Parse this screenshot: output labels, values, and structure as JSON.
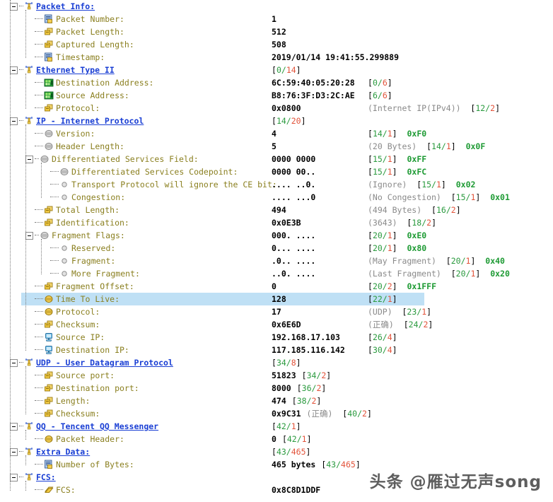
{
  "watermark": "头条 @雁过无声song",
  "rows": [
    {
      "id": "packet-info",
      "kind": "group",
      "depth": 0,
      "expander": "minus",
      "icon": "protocol-node-icon",
      "label": "Packet Info:",
      "value": "",
      "desc": "",
      "offset": "",
      "mask": ""
    },
    {
      "id": "packet-number",
      "kind": "field",
      "depth": 1,
      "expander": "none",
      "icon": "info-page-icon",
      "label": "Packet Number:",
      "value": "1",
      "desc": "",
      "offset": "",
      "mask": ""
    },
    {
      "id": "packet-length",
      "kind": "field",
      "depth": 1,
      "expander": "none",
      "icon": "bytes-icon",
      "label": "Packet Length:",
      "value": "512",
      "desc": "",
      "offset": "",
      "mask": ""
    },
    {
      "id": "captured-length",
      "kind": "field",
      "depth": 1,
      "expander": "none",
      "icon": "bytes-icon",
      "label": "Captured Length:",
      "value": "508",
      "desc": "",
      "offset": "",
      "mask": ""
    },
    {
      "id": "timestamp",
      "kind": "field",
      "depth": 1,
      "expander": "none",
      "icon": "info-page-icon",
      "label": "Timestamp:",
      "value": "2019/01/14 19:41:55.299889",
      "desc": "",
      "offset": "",
      "mask": ""
    },
    {
      "id": "ethernet-type-ii",
      "kind": "group",
      "depth": 0,
      "expander": "minus",
      "icon": "protocol-node-icon",
      "label": "Ethernet Type II",
      "value": "",
      "desc": "",
      "offset": "[0/14]",
      "mask": ""
    },
    {
      "id": "destination-address",
      "kind": "field",
      "depth": 1,
      "expander": "none",
      "icon": "nic-card-icon",
      "label": "Destination Address:",
      "value": "6C:59:40:05:20:28",
      "desc": "",
      "offset": "[0/6]",
      "mask": ""
    },
    {
      "id": "source-address",
      "kind": "field",
      "depth": 1,
      "expander": "none",
      "icon": "nic-card-icon",
      "label": "Source Address:",
      "value": "B8:76:3F:D3:2C:AE",
      "desc": "",
      "offset": "[6/6]",
      "mask": ""
    },
    {
      "id": "eth-protocol",
      "kind": "field",
      "depth": 1,
      "expander": "none",
      "icon": "bytes-icon",
      "label": "Protocol:",
      "value": "0x0800",
      "desc": "(Internet IP(IPv4))",
      "offset": "[12/2]",
      "mask": ""
    },
    {
      "id": "ip-internet-protocol",
      "kind": "group",
      "depth": 0,
      "expander": "minus",
      "icon": "protocol-node-icon",
      "label": "IP - Internet Protocol",
      "value": "",
      "desc": "",
      "offset": "[14/20]",
      "mask": ""
    },
    {
      "id": "ip-version",
      "kind": "field",
      "depth": 1,
      "expander": "none",
      "icon": "bitfield-gray-icon",
      "label": "Version:",
      "value": "4",
      "desc": "",
      "offset": "[14/1]",
      "mask": "0xF0"
    },
    {
      "id": "ip-header-length",
      "kind": "field",
      "depth": 1,
      "expander": "none",
      "icon": "bitfield-gray-icon",
      "label": "Header Length:",
      "value": "5",
      "desc": "(20 Bytes)",
      "offset": "[14/1]",
      "mask": "0x0F"
    },
    {
      "id": "diffserv-field",
      "kind": "field",
      "depth": 1,
      "expander": "minus",
      "icon": "bitfield-gray-icon",
      "label": "Differentiated Services Field:",
      "value": "0000 0000",
      "desc": "",
      "offset": "[15/1]",
      "mask": "0xFF"
    },
    {
      "id": "diffserv-codepoint",
      "kind": "field",
      "depth": 2,
      "expander": "none",
      "icon": "bitfield-gray-icon",
      "label": "Differentiated Services Codepoint:",
      "value": "0000 00..",
      "desc": "",
      "offset": "[15/1]",
      "mask": "0xFC"
    },
    {
      "id": "transport-ignore-ce-bit",
      "kind": "field",
      "depth": 2,
      "expander": "none",
      "icon": "bit-dot-icon",
      "label": "Transport Protocol will ignore the CE bit:",
      "value": ".... ..0.",
      "desc": "(Ignore)",
      "offset": "[15/1]",
      "mask": "0x02"
    },
    {
      "id": "congestion",
      "kind": "field",
      "depth": 2,
      "expander": "none",
      "icon": "bit-dot-icon",
      "label": "Congestion:",
      "value": ".... ...0",
      "desc": "(No Congestion)",
      "offset": "[15/1]",
      "mask": "0x01"
    },
    {
      "id": "total-length",
      "kind": "field",
      "depth": 1,
      "expander": "none",
      "icon": "bytes-icon",
      "label": "Total Length:",
      "value": "494",
      "desc": "(494 Bytes)",
      "offset": "[16/2]",
      "mask": ""
    },
    {
      "id": "identification",
      "kind": "field",
      "depth": 1,
      "expander": "none",
      "icon": "bytes-icon",
      "label": "Identification:",
      "value": "0x0E3B",
      "desc": "(3643)",
      "offset": "[18/2]",
      "mask": ""
    },
    {
      "id": "fragment-flags",
      "kind": "field",
      "depth": 1,
      "expander": "minus",
      "icon": "bitfield-gray-icon",
      "label": "Fragment Flags:",
      "value": "000. ....",
      "desc": "",
      "offset": "[20/1]",
      "mask": "0xE0"
    },
    {
      "id": "reserved",
      "kind": "field",
      "depth": 2,
      "expander": "none",
      "icon": "bit-dot-icon",
      "label": "Reserved:",
      "value": "0... ....",
      "desc": "",
      "offset": "[20/1]",
      "mask": "0x80"
    },
    {
      "id": "fragment",
      "kind": "field",
      "depth": 2,
      "expander": "none",
      "icon": "bit-dot-icon",
      "label": "Fragment:",
      "value": ".0.. ....",
      "desc": "(May Fragment)",
      "offset": "[20/1]",
      "mask": "0x40"
    },
    {
      "id": "more-fragment",
      "kind": "field",
      "depth": 2,
      "expander": "none",
      "icon": "bit-dot-icon",
      "label": "More Fragment:",
      "value": "..0. ....",
      "desc": "(Last Fragment)",
      "offset": "[20/1]",
      "mask": "0x20"
    },
    {
      "id": "fragment-offset",
      "kind": "field",
      "depth": 1,
      "expander": "none",
      "icon": "bytes-icon",
      "label": "Fragment Offset:",
      "value": "0",
      "desc": "",
      "offset": "[20/2]",
      "mask": "0x1FFF"
    },
    {
      "id": "time-to-live",
      "kind": "field",
      "depth": 1,
      "expander": "none",
      "icon": "byte-yellow-icon",
      "label": "Time To Live:",
      "value": "128",
      "desc": "",
      "offset": "[22/1]",
      "mask": "",
      "selected": true
    },
    {
      "id": "ip-protocol",
      "kind": "field",
      "depth": 1,
      "expander": "none",
      "icon": "byte-yellow-icon",
      "label": "Protocol:",
      "value": "17",
      "desc": "(UDP)",
      "offset": "[23/1]",
      "mask": ""
    },
    {
      "id": "ip-checksum",
      "kind": "field",
      "depth": 1,
      "expander": "none",
      "icon": "bytes-icon",
      "label": "Checksum:",
      "value": "0x6E6D",
      "desc": "(正确)",
      "offset": "[24/2]",
      "mask": ""
    },
    {
      "id": "source-ip",
      "kind": "field",
      "depth": 1,
      "expander": "none",
      "icon": "host-monitor-icon",
      "label": "Source IP:",
      "value": "192.168.17.103",
      "desc": "",
      "offset": "[26/4]",
      "mask": ""
    },
    {
      "id": "destination-ip",
      "kind": "field",
      "depth": 1,
      "expander": "none",
      "icon": "host-monitor-icon",
      "label": "Destination IP:",
      "value": "117.185.116.142",
      "desc": "",
      "offset": "[30/4]",
      "mask": ""
    },
    {
      "id": "udp-protocol",
      "kind": "group",
      "depth": 0,
      "expander": "minus",
      "icon": "protocol-node-icon",
      "label": "UDP - User Datagram Protocol",
      "value": "",
      "desc": "",
      "offset": "[34/8]",
      "mask": ""
    },
    {
      "id": "udp-source-port",
      "kind": "field",
      "depth": 1,
      "expander": "none",
      "icon": "bytes-icon",
      "label": "Source port:",
      "value": "51823",
      "desc": "",
      "offset": "[34/2]",
      "mask": "",
      "offsetNear": true
    },
    {
      "id": "udp-destination-port",
      "kind": "field",
      "depth": 1,
      "expander": "none",
      "icon": "bytes-icon",
      "label": "Destination port:",
      "value": "8000",
      "desc": "",
      "offset": "[36/2]",
      "mask": "",
      "offsetNear": true
    },
    {
      "id": "udp-length",
      "kind": "field",
      "depth": 1,
      "expander": "none",
      "icon": "bytes-icon",
      "label": "Length:",
      "value": "474",
      "desc": "",
      "offset": "[38/2]",
      "mask": "",
      "offsetNear": true
    },
    {
      "id": "udp-checksum",
      "kind": "field",
      "depth": 1,
      "expander": "none",
      "icon": "bytes-icon",
      "label": "Checksum:",
      "value": "0x9C31",
      "desc": "(正确)",
      "offset": "[40/2]",
      "mask": "",
      "offsetNear": true
    },
    {
      "id": "qq-tencent-messenger",
      "kind": "group",
      "depth": 0,
      "expander": "minus",
      "icon": "protocol-node-icon",
      "label": "QQ - Tencent QQ Messenger",
      "value": "",
      "desc": "",
      "offset": "[42/1]",
      "mask": ""
    },
    {
      "id": "qq-packet-header",
      "kind": "field",
      "depth": 1,
      "expander": "none",
      "icon": "byte-yellow-icon",
      "label": "Packet Header:",
      "value": "0",
      "desc": "",
      "offset": "[42/1]",
      "mask": "",
      "offsetNear": true
    },
    {
      "id": "extra-data",
      "kind": "group",
      "depth": 0,
      "expander": "minus",
      "icon": "protocol-node-icon",
      "label": "Extra Data:",
      "value": "",
      "desc": "",
      "offset": "[43/465]",
      "mask": ""
    },
    {
      "id": "number-of-bytes",
      "kind": "field",
      "depth": 1,
      "expander": "none",
      "icon": "info-page-icon",
      "label": "Number of Bytes:",
      "value": "465 bytes",
      "desc": "",
      "offset": "[43/465]",
      "mask": "",
      "offsetNear": true
    },
    {
      "id": "fcs-group",
      "kind": "group",
      "depth": 0,
      "expander": "minus",
      "icon": "protocol-node-icon",
      "label": "FCS:",
      "value": "",
      "desc": "",
      "offset": "",
      "mask": ""
    },
    {
      "id": "fcs-value",
      "kind": "field",
      "depth": 1,
      "expander": "none",
      "icon": "stack-icon",
      "label": "FCS:",
      "value": "0x8C8D1DDF",
      "desc": "",
      "offset": "",
      "mask": ""
    }
  ]
}
